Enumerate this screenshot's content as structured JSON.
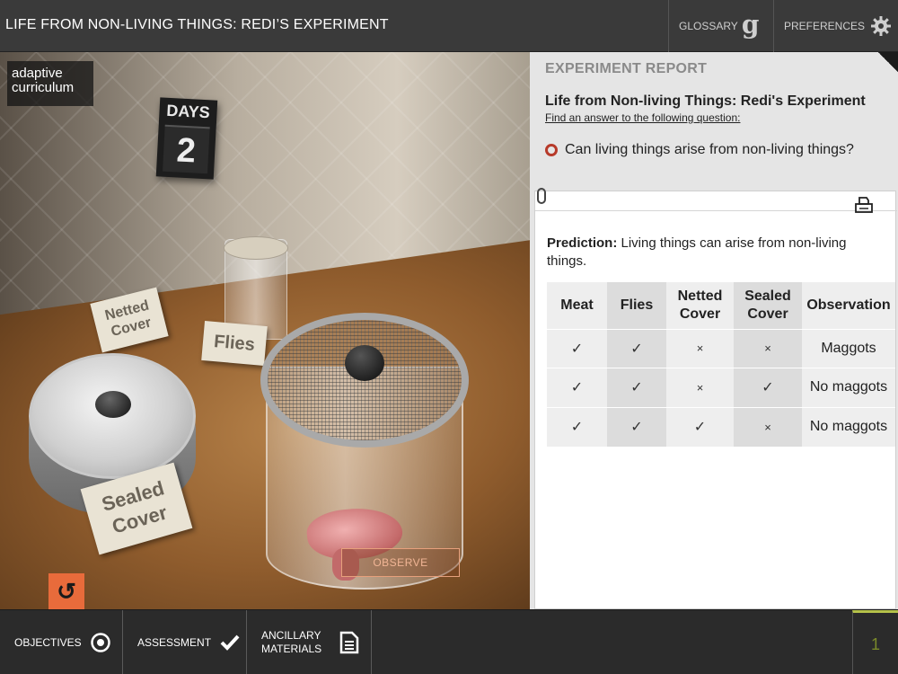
{
  "header": {
    "title": "LIFE FROM NON-LIVING THINGS: REDI’S EXPERIMENT",
    "glossary_label": "GLOSSARY",
    "preferences_label": "PREFERENCES"
  },
  "scene": {
    "logo_line1": "adaptive",
    "logo_line2": "curriculum",
    "days_label": "DAYS",
    "days_value": "2",
    "card_netted": "Netted Cover",
    "card_flies": "Flies",
    "card_sealed": "Sealed Cover",
    "observe_label": "OBSERVE"
  },
  "report": {
    "heading": "EXPERIMENT REPORT",
    "title": "Life from Non-living Things: Redi's Experiment",
    "subtitle": "Find an answer to the following question:",
    "question": "Can living things arise from non-living things?",
    "prediction_label": "Prediction:",
    "prediction_text": " Living things can arise from non-living things.",
    "table": {
      "headers": [
        "Meat",
        "Flies",
        "Netted Cover",
        "Sealed Cover",
        "Observation"
      ],
      "rows": [
        [
          "✓",
          "✓",
          "×",
          "×",
          "Maggots"
        ],
        [
          "✓",
          "✓",
          "×",
          "✓",
          "No maggots"
        ],
        [
          "✓",
          "✓",
          "✓",
          "×",
          "No maggots"
        ]
      ]
    }
  },
  "footer": {
    "objectives_label": "OBJECTIVES",
    "assessment_label": "ASSESSMENT",
    "ancillary_line1": "ANCILLARY",
    "ancillary_line2": "MATERIALS",
    "page_number": "1"
  },
  "colors": {
    "accent_orange": "#e86b3b",
    "question_ring": "#b73a2a",
    "page_indicator": "#b5c24a"
  }
}
